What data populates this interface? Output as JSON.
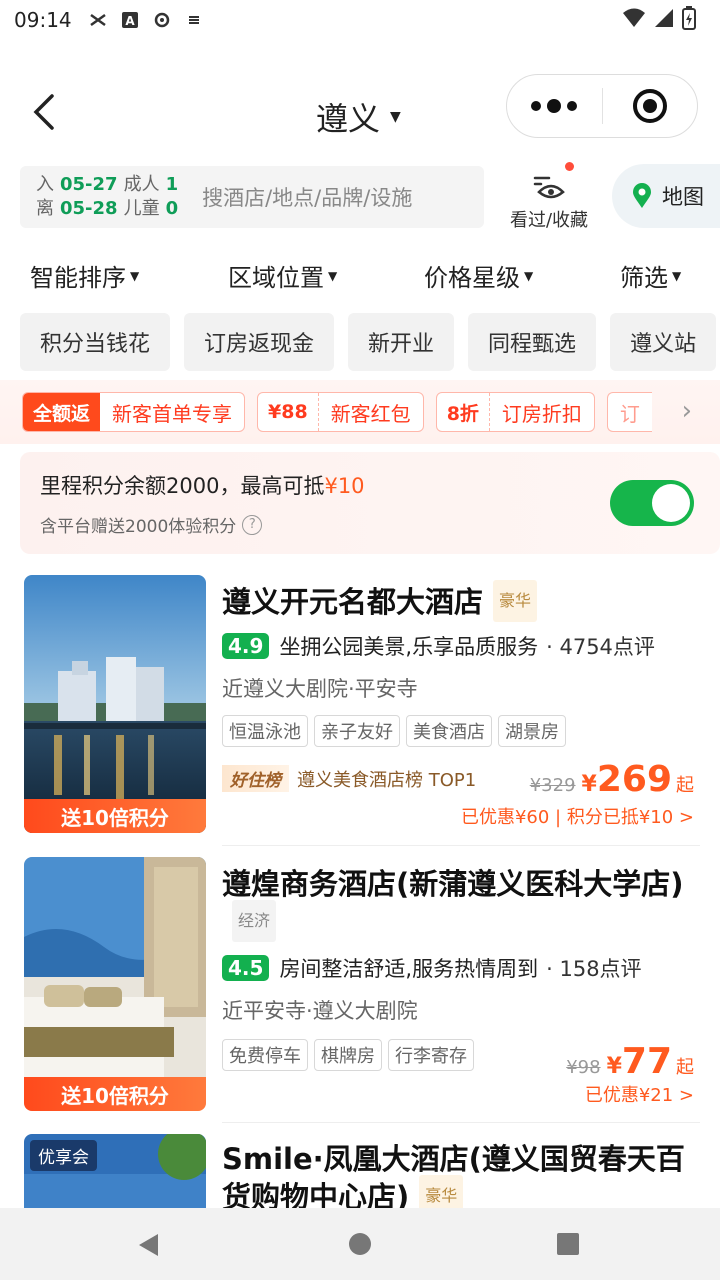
{
  "status": {
    "time": "09:14"
  },
  "header": {
    "city": "遵义"
  },
  "search": {
    "checkin_label": "入",
    "checkin_date": "05-27",
    "checkout_label": "离",
    "checkout_date": "05-28",
    "adult_label": "成人",
    "adult_count": "1",
    "child_label": "儿童",
    "child_count": "0",
    "placeholder": "搜酒店/地点/品牌/设施"
  },
  "history_label": "看过/收藏",
  "map_label": "地图",
  "sort_tabs": [
    "智能排序",
    "区域位置",
    "价格星级",
    "筛选"
  ],
  "chips": [
    "积分当钱花",
    "订房返现金",
    "新开业",
    "同程甄选",
    "遵义站"
  ],
  "promos": [
    {
      "tag": "全额返",
      "text": "新客首单专享"
    },
    {
      "tag": "¥88",
      "text": "新客红包"
    },
    {
      "tag": "8折",
      "text": "订房折扣"
    },
    {
      "tag": "",
      "text": "订"
    }
  ],
  "points": {
    "line1_prefix": "里程积分余额2000，最高可抵",
    "line1_amount": "¥10",
    "line2": "含平台赠送2000体验积分",
    "toggle_on": true
  },
  "hotels": [
    {
      "name": "遵义开元名都大酒店",
      "level": "豪华",
      "score": "4.9",
      "comment": "坐拥公园美景,乐享品质服务",
      "reviews": "· 4754点评",
      "location": "近遵义大剧院·平安寺",
      "tags": [
        "恒温泳池",
        "亲子友好",
        "美食酒店",
        "湖景房"
      ],
      "rank_badge": "好住榜",
      "rank_text": "遵义美食酒店榜 TOP1",
      "old_price": "¥329",
      "currency": "¥",
      "price": "269",
      "price_suffix": "起",
      "discount": "已优惠¥60 | 积分已抵¥10 >",
      "image_badge": "送10倍积分"
    },
    {
      "name": "遵煌商务酒店(新蒲遵义医科大学店)",
      "level": "经济",
      "score": "4.5",
      "comment": "房间整洁舒适,服务热情周到",
      "reviews": "· 158点评",
      "location": "近平安寺·遵义大剧院",
      "tags": [
        "免费停车",
        "棋牌房",
        "行李寄存"
      ],
      "old_price": "¥98",
      "currency": "¥",
      "price": "77",
      "price_suffix": "起",
      "discount": "已优惠¥21 >",
      "image_badge": "送10倍积分"
    },
    {
      "name": "Smile·凤凰大酒店(遵义国贸春天百货购物中心店)",
      "level": "豪华",
      "image_tag": "优享会"
    }
  ]
}
